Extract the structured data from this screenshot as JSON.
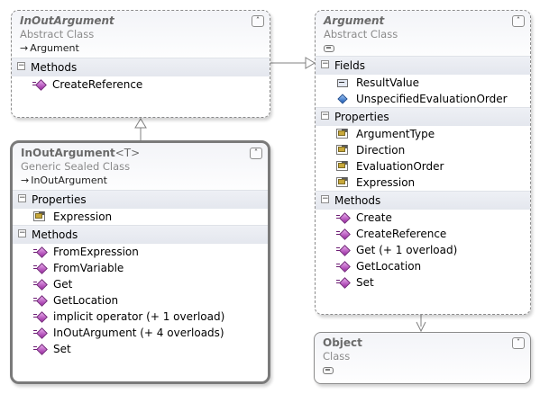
{
  "classes": {
    "inout_abstract": {
      "title": "InOutArgument",
      "subtitle": "Abstract Class",
      "base": "Argument",
      "toggle": "˄",
      "sections": [
        {
          "label": "Methods",
          "items": [
            {
              "label": "CreateReference",
              "icon": "method-icon"
            }
          ]
        }
      ]
    },
    "argument": {
      "title": "Argument",
      "subtitle": "Abstract Class",
      "toggle": "˄",
      "sections": [
        {
          "label": "Fields",
          "items": [
            {
              "label": "ResultValue",
              "icon": "field-icon"
            },
            {
              "label": "UnspecifiedEvaluationOrder",
              "icon": "field2-icon"
            }
          ]
        },
        {
          "label": "Properties",
          "items": [
            {
              "label": "ArgumentType",
              "icon": "property-icon"
            },
            {
              "label": "Direction",
              "icon": "property-icon"
            },
            {
              "label": "EvaluationOrder",
              "icon": "property-icon"
            },
            {
              "label": "Expression",
              "icon": "property-icon"
            }
          ]
        },
        {
          "label": "Methods",
          "items": [
            {
              "label": "Create",
              "icon": "method-icon"
            },
            {
              "label": "CreateReference",
              "icon": "method-icon"
            },
            {
              "label": "Get (+ 1 overload)",
              "icon": "method-icon"
            },
            {
              "label": "GetLocation",
              "icon": "method-icon"
            },
            {
              "label": "Set",
              "icon": "method-icon"
            }
          ]
        }
      ]
    },
    "inout_generic": {
      "title": "InOutArgument",
      "generic": "<T>",
      "subtitle": "Generic Sealed Class",
      "base": "InOutArgument",
      "toggle": "˄",
      "sections": [
        {
          "label": "Properties",
          "items": [
            {
              "label": "Expression",
              "icon": "property-icon"
            }
          ]
        },
        {
          "label": "Methods",
          "items": [
            {
              "label": "FromExpression",
              "icon": "method-icon"
            },
            {
              "label": "FromVariable",
              "icon": "method-icon"
            },
            {
              "label": "Get",
              "icon": "method-icon"
            },
            {
              "label": "GetLocation",
              "icon": "method-icon"
            },
            {
              "label": "implicit operator (+ 1 overload)",
              "icon": "method-icon"
            },
            {
              "label": "InOutArgument (+ 4 overloads)",
              "icon": "method-icon"
            },
            {
              "label": "Set",
              "icon": "method-icon"
            }
          ]
        }
      ]
    },
    "object": {
      "title": "Object",
      "subtitle": "Class",
      "toggle": "˅"
    }
  },
  "symbols": {
    "collapse": "−",
    "inherits": "→"
  }
}
